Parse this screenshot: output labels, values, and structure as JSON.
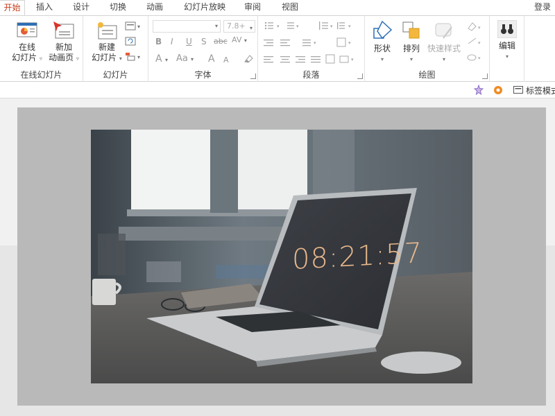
{
  "tabs": [
    {
      "label": "开始",
      "active": true
    },
    {
      "label": "插入"
    },
    {
      "label": "设计"
    },
    {
      "label": "切换"
    },
    {
      "label": "动画"
    },
    {
      "label": "幻灯片放映"
    },
    {
      "label": "审阅"
    },
    {
      "label": "视图"
    }
  ],
  "login": "登录",
  "groups": {
    "online": {
      "label": "在线幻灯片",
      "btn1_line1": "在线",
      "btn1_line2": "幻灯片",
      "btn2_line1": "新加",
      "btn2_line2": "动画页"
    },
    "slides": {
      "label": "幻灯片",
      "new_line1": "新建",
      "new_line2": "幻灯片"
    },
    "font": {
      "label": "字体",
      "size": "7.8+",
      "bold": "B",
      "italic": "I",
      "underline": "U",
      "shadow": "S",
      "strike": "abc",
      "spacing": "AV",
      "color": "A",
      "case": "Aa",
      "grow": "A",
      "shrink": "A"
    },
    "paragraph": {
      "label": "段落"
    },
    "drawing": {
      "label": "绘图",
      "shape": "形状",
      "arrange": "排列",
      "quick_style": "快速样式"
    },
    "edit": {
      "label": "编辑"
    }
  },
  "subbar": {
    "tag_mode": "标签模式"
  },
  "slide": {
    "clock_text": "08:21:57"
  },
  "colors": {
    "accent": "#c43e1c",
    "slide_bg": "#b9b9b9"
  }
}
